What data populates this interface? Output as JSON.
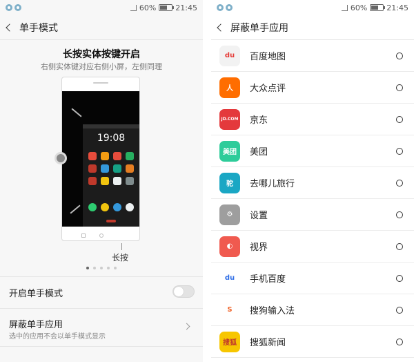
{
  "status": {
    "battery": "60%",
    "time": "21:45"
  },
  "left": {
    "title": "单手模式",
    "guide_title": "长按实体按键开启",
    "guide_sub": "右侧实体键对应右侧小屏，左侧同理",
    "phone_time": "19:08",
    "press_label": "长按",
    "settings": [
      {
        "label": "开启单手模式",
        "enabled": false
      },
      {
        "label": "屏蔽单手应用",
        "desc": "选中的应用不会以单手模式显示"
      }
    ]
  },
  "right": {
    "title": "屏蔽单手应用",
    "apps": [
      {
        "name": "百度地图",
        "icon": "baidu-map-icon",
        "color": "#f2f2f2",
        "glyph": "du",
        "glyph_color": "#e53935"
      },
      {
        "name": "大众点评",
        "icon": "dianping-icon",
        "color": "#ff6d00",
        "glyph": "人",
        "glyph_color": "#ffffff"
      },
      {
        "name": "京东",
        "icon": "jd-icon",
        "color": "#e4393c",
        "glyph": "JD.COM",
        "glyph_color": "#ffffff"
      },
      {
        "name": "美团",
        "icon": "meituan-icon",
        "color": "#2ecc9a",
        "glyph": "美团",
        "glyph_color": "#ffffff"
      },
      {
        "name": "去哪儿旅行",
        "icon": "qunar-icon",
        "color": "#1aa7c4",
        "glyph": "驼",
        "glyph_color": "#ffffff"
      },
      {
        "name": "设置",
        "icon": "settings-icon",
        "color": "#9e9e9e",
        "glyph": "⚙",
        "glyph_color": "#ffffff"
      },
      {
        "name": "视界",
        "icon": "shijie-icon",
        "color": "#f05a4f",
        "glyph": "◐",
        "glyph_color": "#ffffff"
      },
      {
        "name": "手机百度",
        "icon": "mobile-baidu-icon",
        "color": "#ffffff",
        "glyph": "du",
        "glyph_color": "#2f6ee6"
      },
      {
        "name": "搜狗输入法",
        "icon": "sogou-input-icon",
        "color": "#ffffff",
        "glyph": "S",
        "glyph_color": "#f0642a"
      },
      {
        "name": "搜狐新闻",
        "icon": "sohu-news-icon",
        "color": "#f7c600",
        "glyph": "搜狐",
        "glyph_color": "#c0392b"
      }
    ]
  }
}
